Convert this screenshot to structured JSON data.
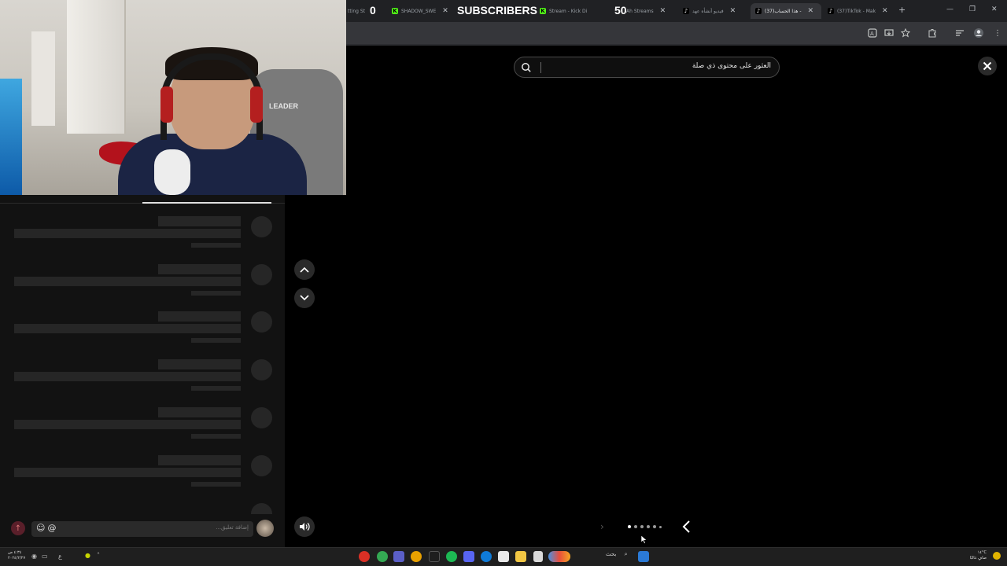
{
  "browser": {
    "tabs": [
      {
        "label": "tting St",
        "active": false
      },
      {
        "label": "SHADOW_SWE",
        "active": false
      },
      {
        "label": "Stream - Kick Di",
        "active": false
      },
      {
        "label": "Ah Streams",
        "active": false
      },
      {
        "label": "فيديو أنشأه عهد",
        "active": false
      },
      {
        "label": "(37)هذا الحساب -",
        "active": true
      },
      {
        "label": "(37)TikTok - Mak",
        "active": false
      }
    ],
    "new_tab_label": "+"
  },
  "stream_overlay": {
    "subscriber_count_left": "0",
    "subscribers_label": "SUBSCRIBERS",
    "goal_count": "50"
  },
  "webcam": {
    "chair_brand": "LEADER"
  },
  "search": {
    "placeholder": "العثور على محتوى ذي صلة"
  },
  "comments": {
    "input_placeholder": "إضافة تعليق...",
    "emoji_icon": "☺",
    "mention_icon": "@",
    "skeleton_rows": 7
  },
  "carousel": {
    "dot_count": 6,
    "active_dot": 0
  },
  "taskbar": {
    "time_left": "٤:٣٤ ص",
    "date_left": "٢٠٢٤/٢/٢٧",
    "search_label": "بحث",
    "weather": "١٤°C",
    "weather_desc": "صافٍ غالبًا"
  },
  "colors": {
    "page_bg": "#000000",
    "panel_bg": "#121212",
    "skeleton": "#262626",
    "tab_bar": "#202124",
    "kick_green": "#53fc18"
  }
}
